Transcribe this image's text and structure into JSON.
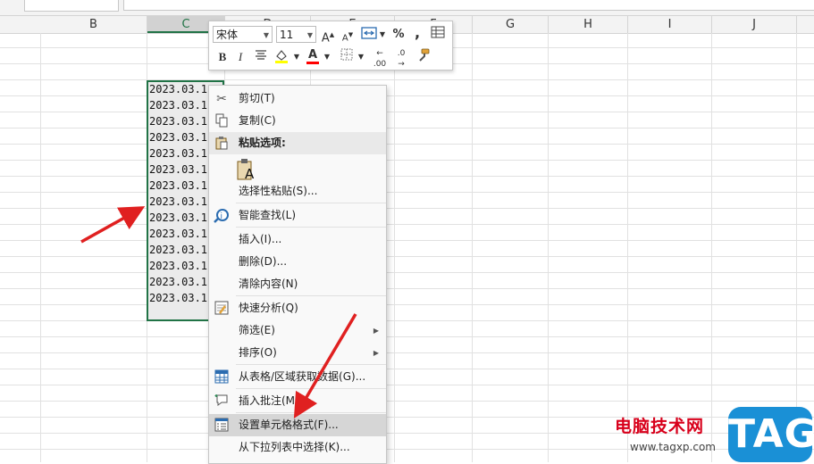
{
  "columns": [
    "B",
    "C",
    "D",
    "E",
    "F",
    "G",
    "H",
    "I",
    "J"
  ],
  "cells": [
    "2023.03.1",
    "2023.03.1",
    "2023.03.1",
    "2023.03.1",
    "2023.03.1",
    "2023.03.1",
    "2023.03.1",
    "2023.03.1",
    "2023.03.1",
    "2023.03.1",
    "2023.03.1",
    "2023.03.1",
    "2023.03.1",
    "2023.03.1"
  ],
  "mini_toolbar": {
    "font_name": "宋体",
    "font_size": "11",
    "percent": "%",
    "comma": ",",
    "bold": "B",
    "italic": "I",
    "font_color_glyph": "A",
    "font_color": "#ff0000",
    "fill_color": "#ffff00",
    "dec_inc": ".00",
    "dec_dec": ".0"
  },
  "menu": {
    "cut": "剪切(T)",
    "copy": "复制(C)",
    "paste_options": "粘贴选项:",
    "paste_special": "选择性粘贴(S)...",
    "smart_lookup": "智能查找(L)",
    "insert": "插入(I)...",
    "delete": "删除(D)...",
    "clear": "清除内容(N)",
    "quick_analysis": "快速分析(Q)",
    "filter": "筛选(E)",
    "sort": "排序(O)",
    "from_table": "从表格/区域获取数据(G)...",
    "insert_comment": "插入批注(M)",
    "format_cells": "设置单元格格式(F)...",
    "pick_list": "从下拉列表中选择(K)..."
  },
  "watermark": {
    "site_name": "电脑技术网",
    "url": "www.tagxp.com",
    "tag": "TAG"
  },
  "colors": {
    "accent": "#217346",
    "arrow": "#e02020",
    "tag_bg": "#1a90d6"
  }
}
